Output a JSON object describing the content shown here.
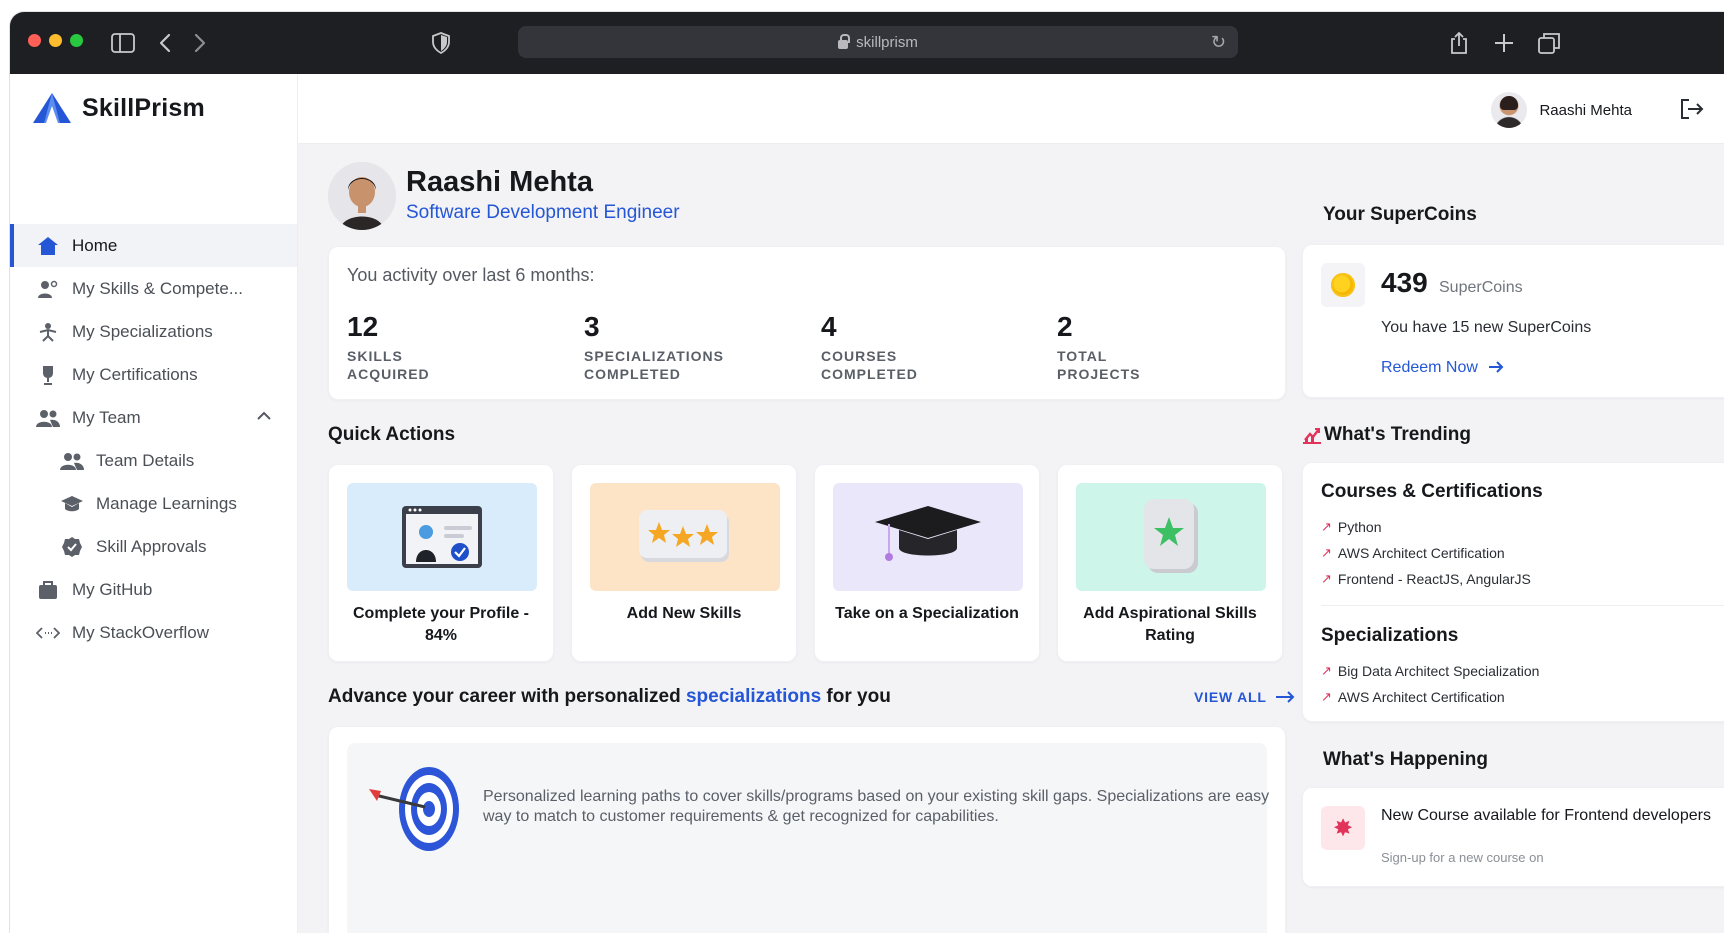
{
  "browser": {
    "url": "skillprism",
    "traffic_colors": [
      "#ff5f57",
      "#febc2e",
      "#28c840"
    ]
  },
  "app": {
    "name": "SkillPrism",
    "brand_color": "#2456d6"
  },
  "header": {
    "user_name": "Raashi Mehta"
  },
  "sidebar": {
    "items": [
      {
        "label": "Home",
        "icon": "home-icon",
        "active": true
      },
      {
        "label": "My Skills & Compete...",
        "icon": "skills-icon"
      },
      {
        "label": "My Specializations",
        "icon": "specialization-icon"
      },
      {
        "label": "My Certifications",
        "icon": "certificate-icon"
      },
      {
        "label": "My Team",
        "icon": "team-icon",
        "expanded": true
      },
      {
        "label": "Team Details",
        "icon": "team-details-icon",
        "sub": true
      },
      {
        "label": "Manage Learnings",
        "icon": "learning-icon",
        "sub": true
      },
      {
        "label": "Skill Approvals",
        "icon": "approval-icon",
        "sub": true
      },
      {
        "label": "My GitHub",
        "icon": "github-icon"
      },
      {
        "label": "My StackOverflow",
        "icon": "code-icon"
      }
    ]
  },
  "profile": {
    "name": "Raashi Mehta",
    "role": "Software Development Engineer"
  },
  "activity": {
    "title": "You activity over last 6 months:",
    "stats": [
      {
        "value": "12",
        "label": "SKILLS\nACQUIRED"
      },
      {
        "value": "3",
        "label": "SPECIALIZATIONS\nCOMPLETED"
      },
      {
        "value": "4",
        "label": "COURSES\nCOMPLETED"
      },
      {
        "value": "2",
        "label": "TOTAL\nPROJECTS"
      }
    ]
  },
  "quick_actions": {
    "title": "Quick Actions",
    "items": [
      {
        "label": "Complete your Profile - 84%",
        "bg": "#d9ecfb"
      },
      {
        "label": "Add New Skills",
        "bg": "#fde4c6"
      },
      {
        "label": "Take on a Specialization",
        "bg": "#ebe7fb"
      },
      {
        "label": "Add Aspirational Skills Rating",
        "bg": "#cdf5ea"
      }
    ]
  },
  "advance": {
    "prefix": "Advance your career with personalized ",
    "highlight": "specializations",
    "suffix": " for you",
    "view_all": "VIEW ALL",
    "description": "Personalized learning paths to cover skills/programs based on your existing skill gaps. Specializations are easy way to match to customer requirements & get recognized for capabilities."
  },
  "supercoins": {
    "title": "Your SuperCoins",
    "count": "439",
    "unit": "SuperCoins",
    "message": "You have 15 new SuperCoins",
    "redeem": "Redeem Now"
  },
  "trending": {
    "title": "What's Trending",
    "courses_title": "Courses & Certifications",
    "courses": [
      "Python",
      "AWS Architect Certification",
      "Frontend - ReactJS, AngularJS"
    ],
    "specializations_title": "Specializations",
    "specializations": [
      "Big Data Architect Specialization",
      "AWS Architect Certification"
    ]
  },
  "happening": {
    "title": "What's Happening",
    "item_title": "New Course available for Frontend developers",
    "item_sub": "Sign-up for a new course on"
  }
}
